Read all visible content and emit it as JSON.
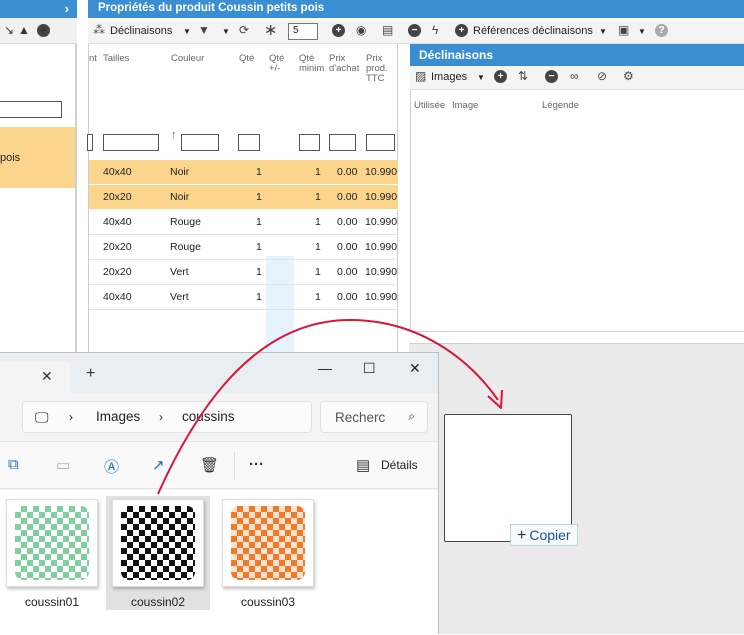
{
  "left_panel": {
    "selected_text": "pois"
  },
  "main": {
    "title": "Propriétés du produit Coussin petits pois",
    "toolbar": {
      "declinaisons_label": "Déclinaisons",
      "quantity_value": "5",
      "references_label": "Références déclinaisons"
    },
    "columns": [
      "nt",
      "Tailles",
      "Couleur",
      "Qté",
      "Qté +/-",
      "Qté minim",
      "Prix d'achat",
      "Prix prod. TTC"
    ],
    "rows": [
      {
        "taille": "40x40",
        "couleur": "Noir",
        "qte": "1",
        "min": "1",
        "achat": "0.00",
        "ttc": "10.990",
        "selected": true
      },
      {
        "taille": "20x20",
        "couleur": "Noir",
        "qte": "1",
        "min": "1",
        "achat": "0.00",
        "ttc": "10.990",
        "selected": true
      },
      {
        "taille": "40x40",
        "couleur": "Rouge",
        "qte": "1",
        "min": "1",
        "achat": "0.00",
        "ttc": "10.990",
        "selected": false
      },
      {
        "taille": "20x20",
        "couleur": "Rouge",
        "qte": "1",
        "min": "1",
        "achat": "0.00",
        "ttc": "10.990",
        "selected": false
      },
      {
        "taille": "20x20",
        "couleur": "Vert",
        "qte": "1",
        "min": "1",
        "achat": "0.00",
        "ttc": "10.990",
        "selected": false
      },
      {
        "taille": "40x40",
        "couleur": "Vert",
        "qte": "1",
        "min": "1",
        "achat": "0.00",
        "ttc": "10.990",
        "selected": false
      }
    ]
  },
  "declinaisons": {
    "title": "Déclinaisons",
    "images_label": "Images",
    "columns": [
      "Utilisée",
      "Image",
      "Légende"
    ]
  },
  "drop": {
    "copy_label": "Copier"
  },
  "explorer": {
    "breadcrumb": [
      "Images",
      "coussins"
    ],
    "search_placeholder": "Recherc",
    "details_label": "Détails",
    "files": [
      {
        "name": "coussin01",
        "color": "#7fcf9f",
        "selected": false
      },
      {
        "name": "coussin02",
        "color": "#111111",
        "selected": true
      },
      {
        "name": "coussin03",
        "color": "#f07a2a",
        "selected": false
      }
    ]
  },
  "colors": {
    "accent_blue": "#3a8fd2",
    "selection_orange": "#fbd58c",
    "arrow_red": "#d6163a"
  }
}
